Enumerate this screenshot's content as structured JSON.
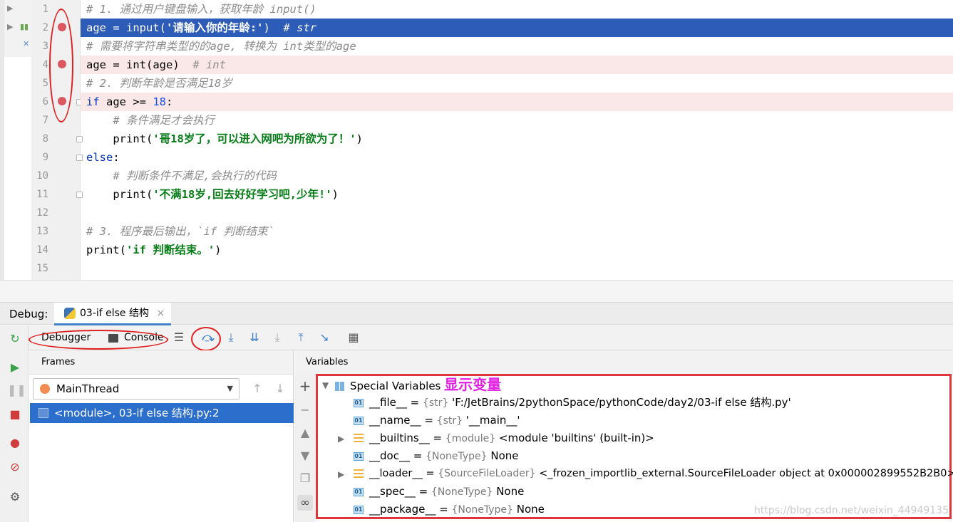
{
  "editor": {
    "line_numbers": [
      "1",
      "2",
      "3",
      "4",
      "5",
      "6",
      "7",
      "8",
      "9",
      "10",
      "11",
      "12",
      "13",
      "14",
      "15"
    ]
  },
  "debug": {
    "panel_label": "Debug:",
    "tab_label": "03-if else 结构",
    "tab_close": "×",
    "toolbar": {
      "debugger_label": "Debugger",
      "console_label": "Console"
    },
    "frames": {
      "header": "Frames",
      "thread": "MainThread",
      "frame_row": "<module>, 03-if else 结构.py:2"
    },
    "variables": {
      "header": "Variables",
      "group_label": "Special Variables",
      "annotation": "显示变量",
      "rows": [
        {
          "name": "__file__",
          "type": "{str}",
          "value": "'F:/JetBrains/2pythonSpace/pythonCode/day2/03-if else 结构.py'"
        },
        {
          "name": "__name__",
          "type": "{str}",
          "value": "'__main__'"
        },
        {
          "name": "__builtins__",
          "type": "{module}",
          "value": "<module 'builtins' (built-in)>"
        },
        {
          "name": "__doc__",
          "type": "{NoneType}",
          "value": "None"
        },
        {
          "name": "__loader__",
          "type": "{SourceFileLoader}",
          "value": "<_frozen_importlib_external.SourceFileLoader object at 0x000002899552B2B0>"
        },
        {
          "name": "__spec__",
          "type": "{NoneType}",
          "value": "None"
        },
        {
          "name": "__package__",
          "type": "{NoneType}",
          "value": "None"
        }
      ]
    }
  },
  "code": {
    "l1": "# 1. 通过用户键盘输入，获取年龄 input()",
    "l2_code": "age = input(",
    "l2_str": "'请输入你的年龄:'",
    "l2_close": ")  ",
    "l2_comment": "# str",
    "l3": "# 需要将字符串类型的的age, 转换为 int类型的age",
    "l4_code": "age = int(age)  ",
    "l4_comment": "# int",
    "l5": "# 2. 判断年龄是否满足18岁",
    "l6_kw": "if",
    "l6_code": " age >= ",
    "l6_num": "18",
    "l6_colon": ":",
    "l7": "    # 条件满足才会执行",
    "l8_code": "    print(",
    "l8_str": "'哥18岁了，可以进入网吧为所欲为了！'",
    "l8_close": ")",
    "l9_kw": "else",
    "l9_colon": ":",
    "l10": "    # 判断条件不满足,会执行的代码",
    "l11_code": "    print(",
    "l11_str": "'不满18岁,回去好好学习吧,少年!'",
    "l11_close": ")",
    "l13": "# 3. 程序最后输出，`if 判断结束`",
    "l14_code": "print(",
    "l14_str": "'if 判断结束。'",
    "l14_close": ")"
  },
  "watermark": "https://blog.csdn.net/weixin_44949135"
}
